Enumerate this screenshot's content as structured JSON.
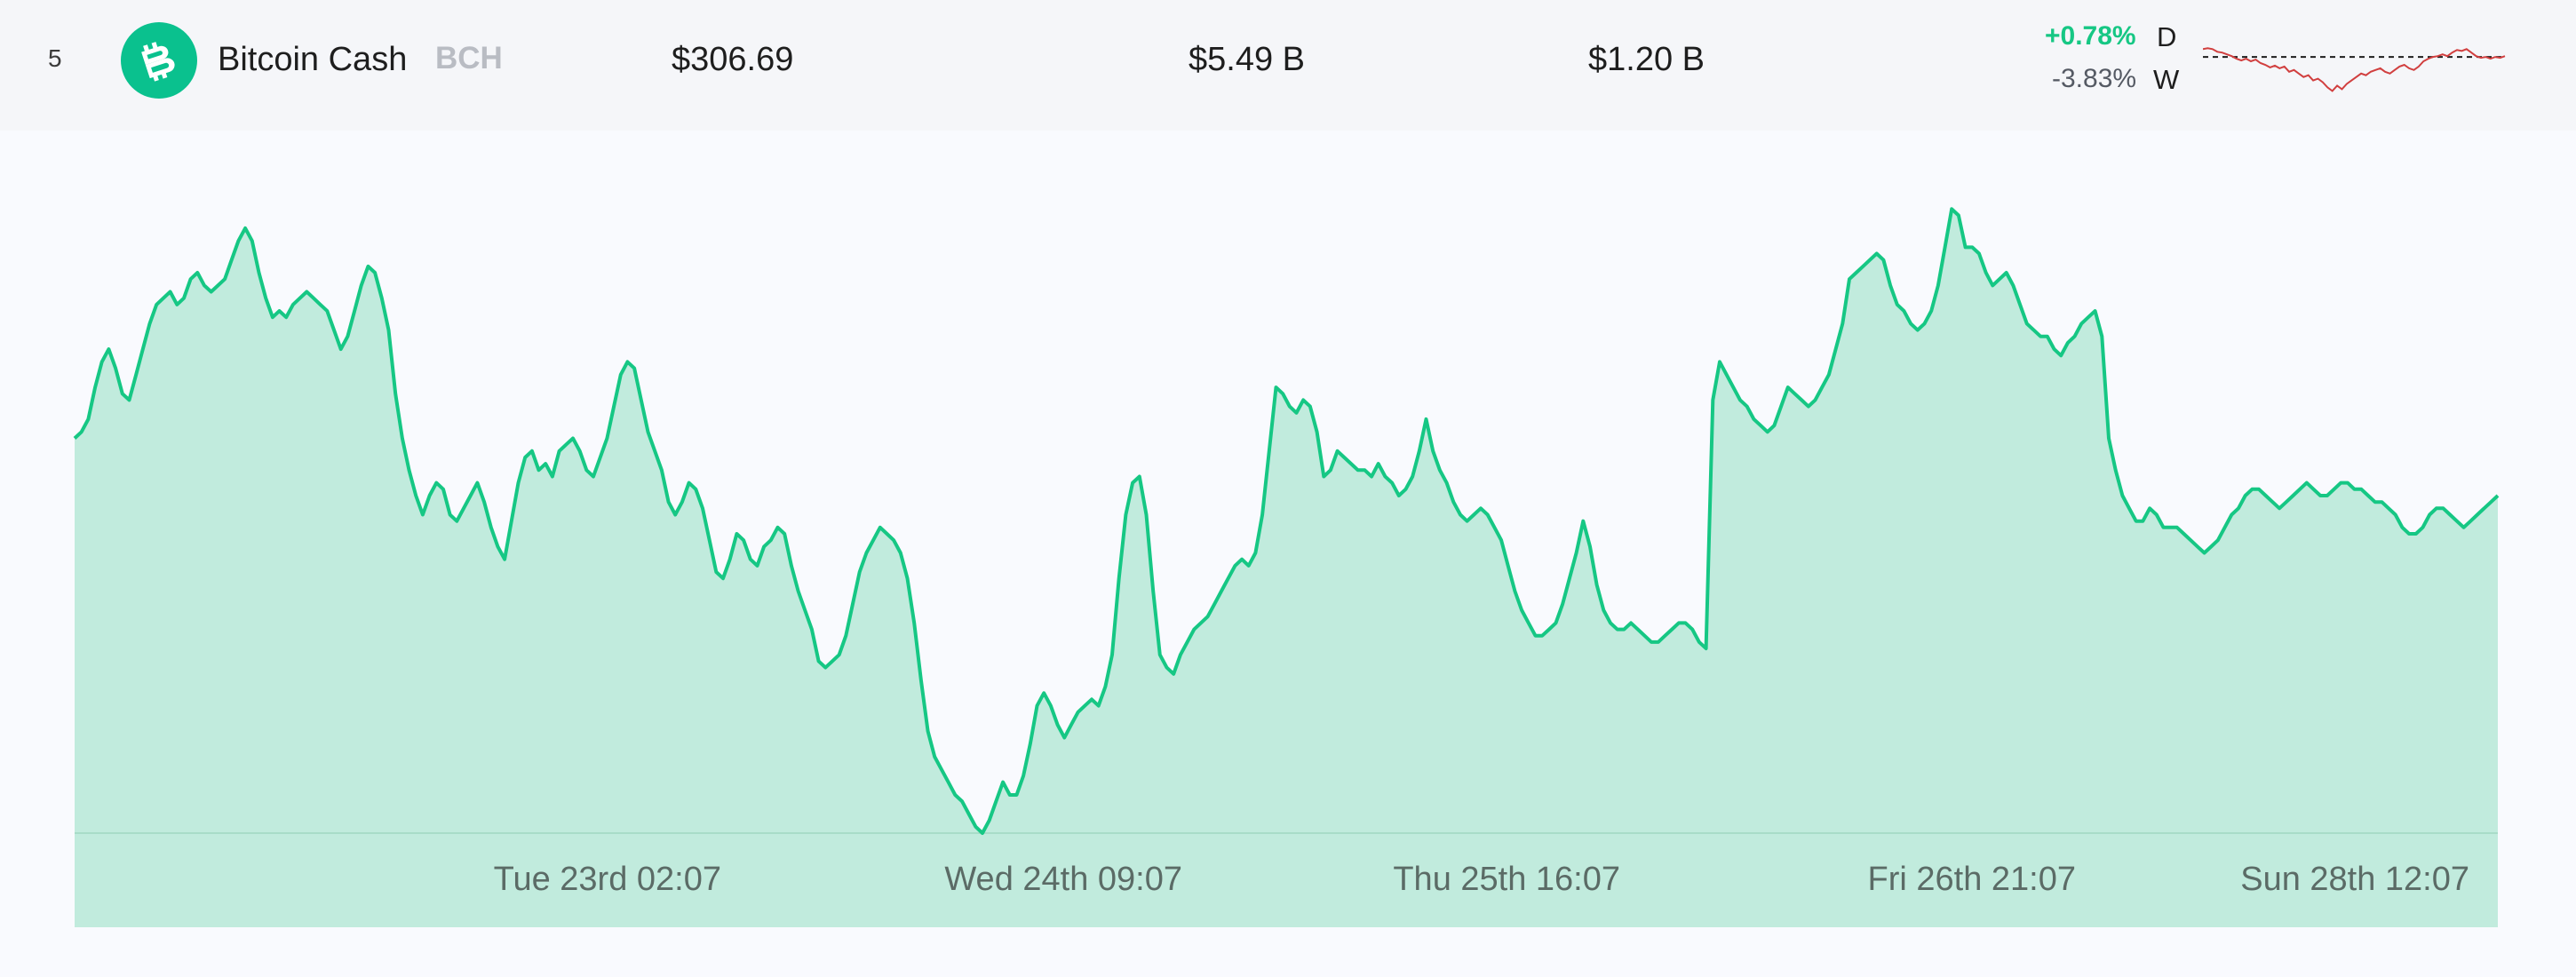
{
  "coin": {
    "rank": "5",
    "name": "Bitcoin Cash",
    "symbol": "BCH",
    "price": "$306.69",
    "market_cap": "$5.49 B",
    "volume": "$1.20 B",
    "change_day": "+0.78%",
    "change_day_label": "D",
    "change_week": "-3.83%",
    "change_week_label": "W",
    "icon": "bitcoin-cash-icon",
    "colors": {
      "brand": "#0ac18e",
      "positive": "#16c784",
      "negative": "#d13f3f",
      "line": "#16c784",
      "fill": "#c1ebdd"
    }
  },
  "chart_data": {
    "type": "area",
    "title": "",
    "xlabel": "",
    "ylabel": "",
    "x_ticks": [
      "Tue 23rd 02:07",
      "Wed 24th 09:07",
      "Thu 25th 16:07",
      "Fri 26th 21:07",
      "Sun 28th 12:07"
    ],
    "ylim": [
      0,
      100
    ],
    "values": [
      62,
      63,
      65,
      70,
      74,
      76,
      73,
      69,
      68,
      72,
      76,
      80,
      83,
      84,
      85,
      83,
      84,
      87,
      88,
      86,
      85,
      86,
      87,
      90,
      93,
      95,
      93,
      88,
      84,
      81,
      82,
      81,
      83,
      84,
      85,
      84,
      83,
      82,
      79,
      76,
      78,
      82,
      86,
      89,
      88,
      84,
      79,
      69,
      62,
      57,
      53,
      50,
      53,
      55,
      54,
      50,
      49,
      51,
      53,
      55,
      52,
      48,
      45,
      43,
      49,
      55,
      59,
      60,
      57,
      58,
      56,
      60,
      61,
      62,
      60,
      57,
      56,
      59,
      62,
      67,
      72,
      74,
      73,
      68,
      63,
      60,
      57,
      52,
      50,
      52,
      55,
      54,
      51,
      46,
      41,
      40,
      43,
      47,
      46,
      43,
      42,
      45,
      46,
      48,
      47,
      42,
      38,
      35,
      32,
      27,
      26,
      27,
      28,
      31,
      36,
      41,
      44,
      46,
      48,
      47,
      46,
      44,
      40,
      33,
      24,
      16,
      12,
      10,
      8,
      6,
      5,
      3,
      1,
      0,
      2,
      5,
      8,
      6,
      6,
      9,
      14,
      20,
      22,
      20,
      17,
      15,
      17,
      19,
      20,
      21,
      20,
      23,
      28,
      40,
      50,
      55,
      56,
      50,
      38,
      28,
      26,
      25,
      28,
      30,
      32,
      33,
      34,
      36,
      38,
      40,
      42,
      43,
      42,
      44,
      50,
      60,
      70,
      69,
      67,
      66,
      68,
      67,
      63,
      56,
      57,
      60,
      59,
      58,
      57,
      57,
      56,
      58,
      56,
      55,
      53,
      54,
      56,
      60,
      65,
      60,
      57,
      55,
      52,
      50,
      49,
      50,
      51,
      50,
      48,
      46,
      42,
      38,
      35,
      33,
      31,
      31,
      32,
      33,
      36,
      40,
      44,
      49,
      45,
      39,
      35,
      33,
      32,
      32,
      33,
      32,
      31,
      30,
      30,
      31,
      32,
      33,
      33,
      32,
      30,
      29,
      68,
      74,
      72,
      70,
      68,
      67,
      65,
      64,
      63,
      64,
      67,
      70,
      69,
      68,
      67,
      68,
      70,
      72,
      76,
      80,
      87,
      88,
      89,
      90,
      91,
      90,
      86,
      83,
      82,
      80,
      79,
      80,
      82,
      86,
      92,
      98,
      97,
      92,
      92,
      91,
      88,
      86,
      87,
      88,
      86,
      83,
      80,
      79,
      78,
      78,
      76,
      75,
      77,
      78,
      80,
      81,
      82,
      78,
      62,
      57,
      53,
      51,
      49,
      49,
      51,
      50,
      48,
      48,
      48,
      47,
      46,
      45,
      44,
      45,
      46,
      48,
      50,
      51,
      53,
      54,
      54,
      53,
      52,
      51,
      52,
      53,
      54,
      55,
      54,
      53,
      53,
      54,
      55,
      55,
      54,
      54,
      53,
      52,
      52,
      51,
      50,
      48,
      47,
      47,
      48,
      50,
      51,
      51,
      50,
      49,
      48,
      49,
      50,
      51,
      52,
      53
    ]
  },
  "sparkline": {
    "values": [
      66,
      67,
      66,
      63,
      62,
      60,
      58,
      55,
      53,
      55,
      52,
      54,
      50,
      48,
      45,
      47,
      44,
      46,
      40,
      42,
      38,
      34,
      36,
      30,
      32,
      28,
      22,
      18,
      24,
      20,
      26,
      30,
      34,
      38,
      36,
      40,
      42,
      44,
      40,
      38,
      42,
      46,
      48,
      44,
      42,
      46,
      52,
      55,
      57,
      58,
      60,
      58,
      62,
      65,
      64,
      66,
      62,
      58,
      56,
      57,
      55,
      57,
      56,
      58
    ],
    "baseline": 57
  }
}
